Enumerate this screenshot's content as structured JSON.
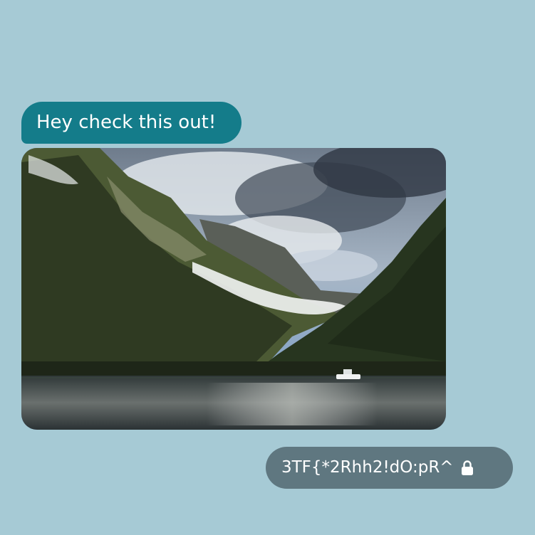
{
  "messages": [
    {
      "direction": "incoming",
      "type": "text",
      "text": "Hey check this out!"
    },
    {
      "direction": "incoming",
      "type": "image",
      "icon": "landscape-photo"
    },
    {
      "direction": "outgoing",
      "type": "text",
      "text": "3TF{*2Rhh2!dO:pR^",
      "icon": "lock-icon"
    }
  ],
  "colors": {
    "background": "#a6cad5",
    "incoming_bubble": "#147c8a",
    "outgoing_bubble": "#5f7780",
    "text": "#ffffff"
  }
}
